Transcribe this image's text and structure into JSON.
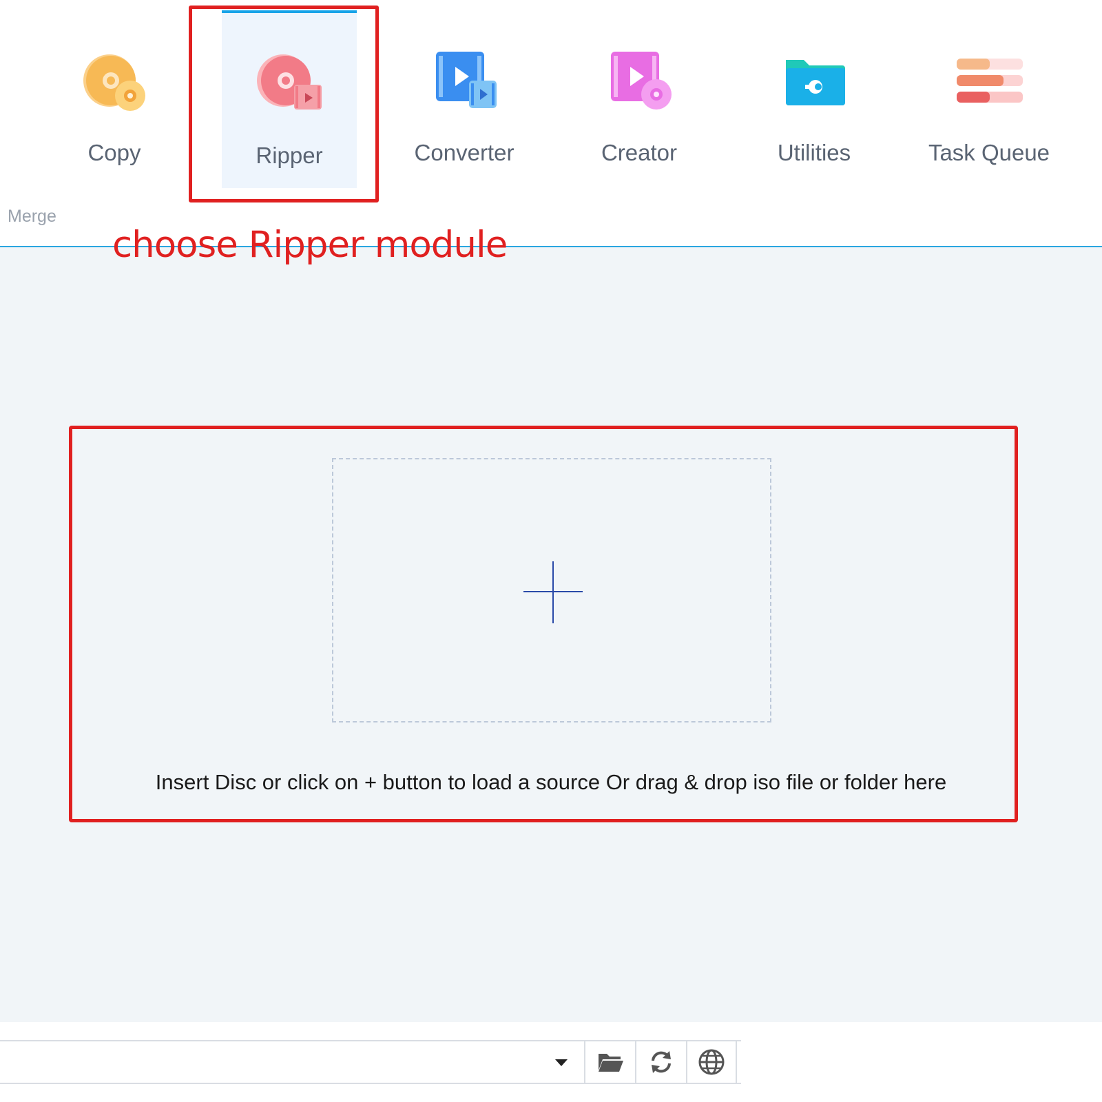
{
  "modules": [
    {
      "label": "Copy",
      "icon": "copy-disc-icon",
      "active": false
    },
    {
      "label": "Ripper",
      "icon": "ripper-disc-icon",
      "active": true
    },
    {
      "label": "Converter",
      "icon": "converter-film-icon",
      "active": false
    },
    {
      "label": "Creator",
      "icon": "creator-film-icon",
      "active": false
    },
    {
      "label": "Utilities",
      "icon": "utilities-folder-icon",
      "active": false
    },
    {
      "label": "Task Queue",
      "icon": "task-queue-icon",
      "active": false
    }
  ],
  "merge_label": "Merge",
  "annotation": {
    "caption": "choose Ripper module",
    "color": "#e02020"
  },
  "dropzone": {
    "hint": "Insert Disc or click on + button to load a source Or drag & drop iso file or folder here"
  },
  "bottom": {
    "source_value": "",
    "buttons": [
      "folder-open-icon",
      "refresh-icon",
      "globe-icon"
    ]
  },
  "colors": {
    "accent": "#17a3e8",
    "divider": "#2aa6e0",
    "content_bg": "#f1f5f8",
    "plus": "#2a4aa8"
  }
}
